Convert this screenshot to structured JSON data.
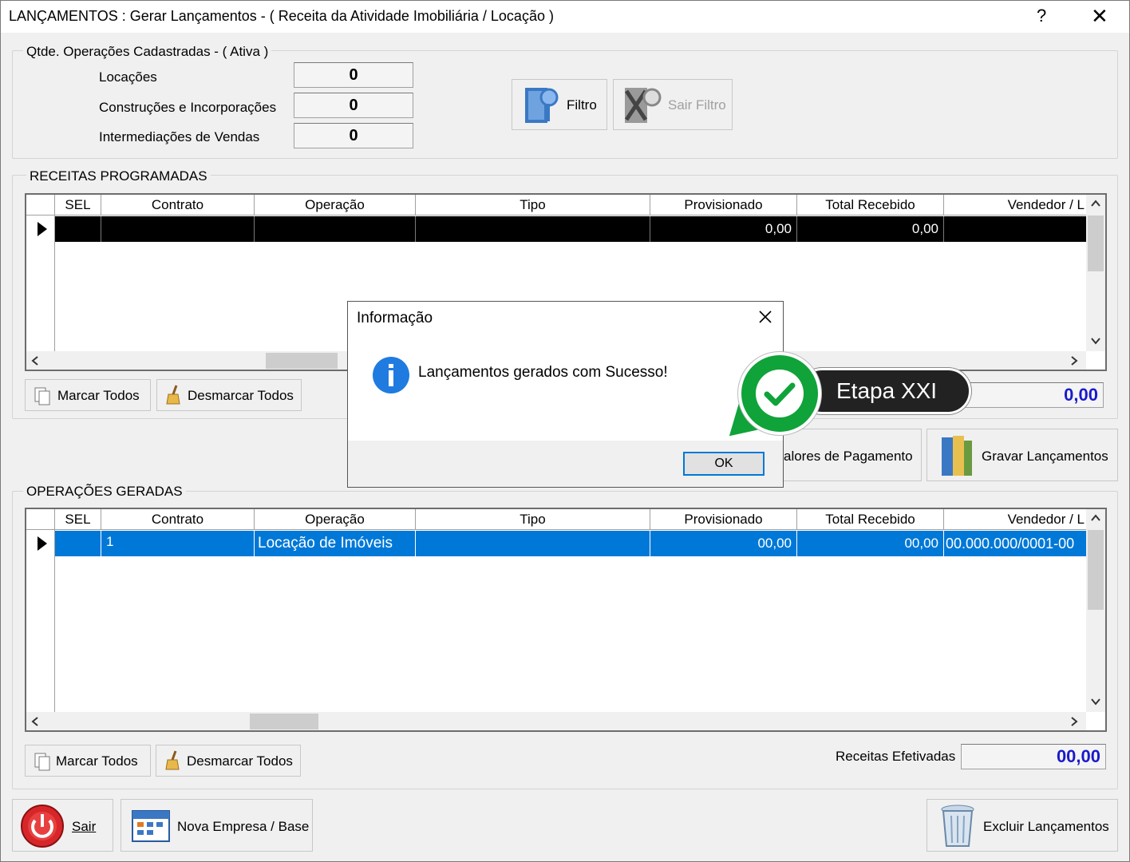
{
  "window": {
    "title": "LANÇAMENTOS : Gerar Lançamentos - ( Receita da Atividade Imobiliária / Locação )",
    "help": "?",
    "close": "✕"
  },
  "counts": {
    "legend": "Qtde. Operações Cadastradas - ( Ativa )",
    "rows": [
      {
        "label": "Locações",
        "value": "0"
      },
      {
        "label": "Construções e Incorporações",
        "value": "0"
      },
      {
        "label": "Intermediações de Vendas",
        "value": "0"
      }
    ],
    "filtro_label": "Filtro",
    "sair_filtro_label": "Sair Filtro"
  },
  "receitas": {
    "legend": "RECEITAS PROGRAMADAS",
    "columns": [
      "SEL",
      "Contrato",
      "Operação",
      "Tipo",
      "Provisionado",
      "Total Recebido",
      "Vendedor / L"
    ],
    "row": {
      "provisionado": "0,00",
      "total_recebido": "0,00"
    },
    "marcar_todos": "Marcar Todos",
    "desmarcar_todos": "Desmarcar Todos",
    "total": "0,00"
  },
  "actions": {
    "valores_pagamento": "alores de Pagamento",
    "gravar_lancamentos": "Gravar Lançamentos"
  },
  "operacoes": {
    "legend": "OPERAÇÕES GERADAS",
    "columns": [
      "SEL",
      "Contrato",
      "Operação",
      "Tipo",
      "Provisionado",
      "Total Recebido",
      "Vendedor / L"
    ],
    "row": {
      "contrato": "1",
      "operacao": "Locação de Imóveis",
      "provisionado": "00,00",
      "total_recebido": "00,00",
      "vendedor": "00.000.000/0001-00"
    },
    "marcar_todos": "Marcar Todos",
    "desmarcar_todos": "Desmarcar Todos",
    "receitas_label": "Receitas Efetivadas",
    "receitas_value": "00,00"
  },
  "footer": {
    "sair": "Sair",
    "nova_empresa": "Nova Empresa / Base",
    "excluir": "Excluir Lançamentos"
  },
  "dialog": {
    "title": "Informação",
    "message": "Lançamentos gerados com Sucesso!",
    "ok": "OK"
  },
  "annotation": {
    "label": "Etapa XXI"
  },
  "colors": {
    "selection": "#0078d7",
    "accent_blue": "#1a1acc",
    "badge_green": "#0fa33a"
  }
}
